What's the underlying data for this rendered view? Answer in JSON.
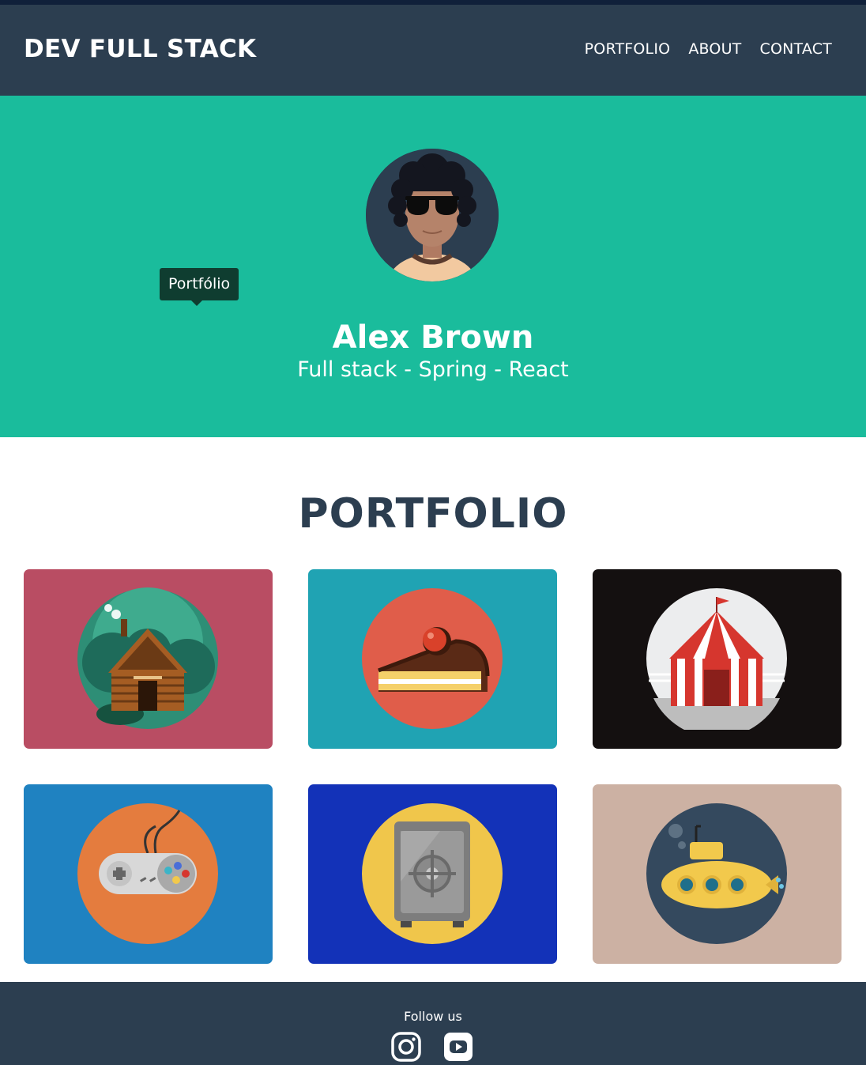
{
  "navbar": {
    "brand": "DEV FULL STACK",
    "links": [
      "PORTFOLIO",
      "ABOUT",
      "CONTACT"
    ]
  },
  "hero": {
    "tooltip": "Portfólio",
    "name": "Alex Brown",
    "subtitle": "Full stack - Spring - React"
  },
  "portfolio": {
    "title": "PORTFOLIO",
    "items": [
      {
        "icon": "log-cabin-icon",
        "bg": "#b94d63"
      },
      {
        "icon": "cake-slice-icon",
        "bg": "#20a3b3"
      },
      {
        "icon": "circus-tent-icon",
        "bg": "#141010"
      },
      {
        "icon": "game-controller-icon",
        "bg": "#1f82c1"
      },
      {
        "icon": "safe-icon",
        "bg": "#1332b8"
      },
      {
        "icon": "submarine-icon",
        "bg": "#ccb1a3"
      }
    ]
  },
  "footer": {
    "follow_label": "Follow us",
    "social": [
      "instagram-icon",
      "youtube-icon"
    ]
  },
  "colors": {
    "navbar": "#2c3e50",
    "hero": "#1abc9c",
    "heading": "#2c3e50"
  }
}
